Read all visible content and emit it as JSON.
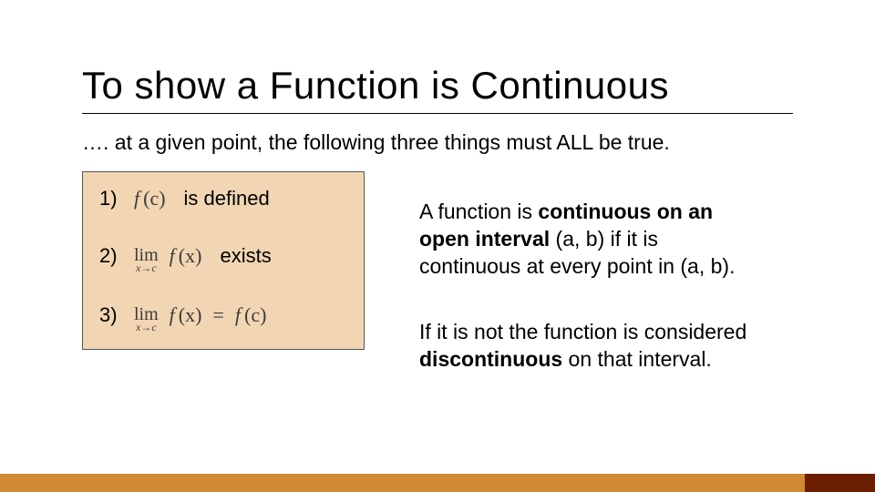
{
  "title": "To show a Function is Continuous",
  "subtitle": "…. at a given point, the following three things must ALL be true.",
  "conditions": {
    "c1": {
      "num": "1)",
      "expr_f": "f",
      "expr_arg": "(c)",
      "after": "is defined"
    },
    "c2": {
      "num": "2)",
      "lim": "lim",
      "sub": "x→c",
      "expr_f": "f",
      "expr_arg": "(x)",
      "after": "exists"
    },
    "c3": {
      "num": "3)",
      "lim": "lim",
      "sub": "x→c",
      "expr_f": "f",
      "expr_arg": "(x)",
      "eq": "=",
      "rf": "f",
      "rarg": "(c)"
    }
  },
  "right": {
    "p1a": "A function is ",
    "p1b": "continuous on an open interval",
    "p1c": " (a, b) if it is continuous at every point in (a, b).",
    "p2a": "If it is not the function is considered ",
    "p2b": "discontinuous",
    "p2c": " on that interval."
  }
}
